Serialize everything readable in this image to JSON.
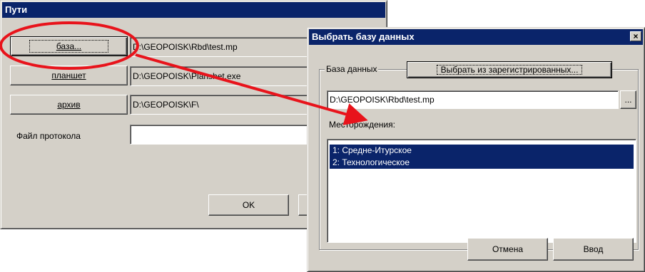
{
  "paths_dialog": {
    "title": "Пути",
    "base_button": "база...",
    "base_path": "D:\\GEOPOISK\\Rbd\\test.mp",
    "planshet_button": "планшет",
    "planshet_path": "D:\\GEOPOISK\\Planshet.exe",
    "archive_button": "архив",
    "archive_path": "D:\\GEOPOISK\\F\\",
    "protocol_label": "Файл протокола",
    "protocol_value": "",
    "ok_button": "OK"
  },
  "select_db_dialog": {
    "title": "Выбрать базу данных",
    "close_glyph": "×",
    "group_label": "База данных",
    "select_registered_button": "Выбрать из зарегистрированных...",
    "db_path": "D:\\GEOPOISK\\Rbd\\test.mp",
    "browse_button": "...",
    "fields_label": "Месторождения:",
    "fields": [
      "1: Средне-Итурское",
      "2: Технологическое"
    ],
    "cancel_button": "Отмена",
    "enter_button": "Ввод"
  },
  "annotation": {
    "color": "#e8131b"
  }
}
